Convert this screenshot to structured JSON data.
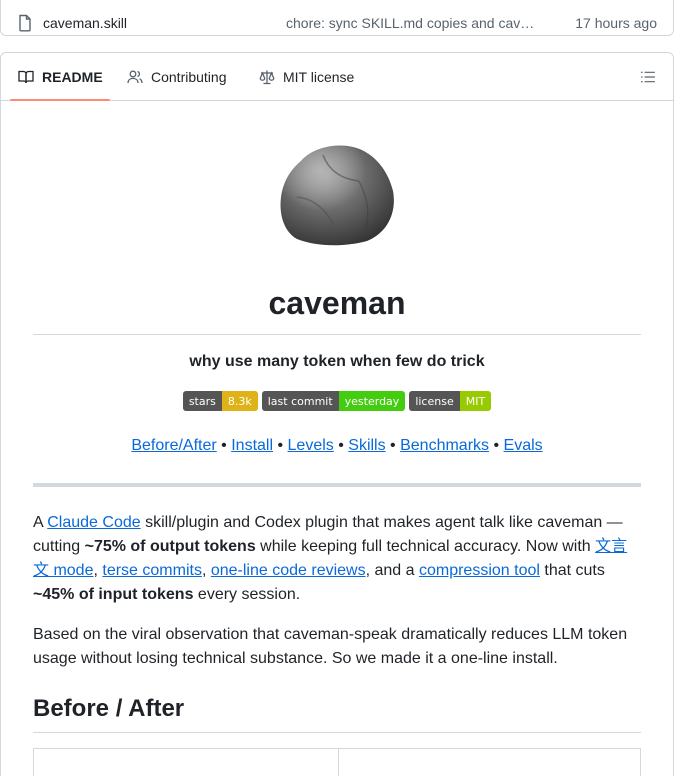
{
  "file_row": {
    "name": "caveman.skill",
    "commit_message": "chore: sync SKILL.md copies and cav…",
    "time": "17 hours ago"
  },
  "tabs": [
    {
      "label": "README",
      "icon": "book-icon",
      "active": true
    },
    {
      "label": "Contributing",
      "icon": "people-icon",
      "active": false
    },
    {
      "label": "MIT license",
      "icon": "law-icon",
      "active": false
    }
  ],
  "readme": {
    "title": "caveman",
    "tagline": "why use many token when few do trick",
    "badges": [
      {
        "label": "stars",
        "value": "8.3k",
        "color": "#dfb317"
      },
      {
        "label": "last commit",
        "value": "yesterday",
        "color": "#4c1"
      },
      {
        "label": "license",
        "value": "MIT",
        "color": "#97ca00"
      }
    ],
    "nav": {
      "before_after": "Before/After",
      "install": "Install",
      "levels": "Levels",
      "skills": "Skills",
      "benchmarks": "Benchmarks",
      "evals": "Evals",
      "separator": " • "
    },
    "p1": {
      "t1": "A ",
      "link_claude": "Claude Code",
      "t2": " skill/plugin and Codex plugin that makes agent talk like caveman — cutting ",
      "bold_output": "~75% of output tokens",
      "t3": " while keeping full technical accuracy. Now with ",
      "link_wenyan": "文言文 mode",
      "t4": ", ",
      "link_terse": "terse commits",
      "t5": ", ",
      "link_oneline": "one-line code reviews",
      "t6": ", and a ",
      "link_compression": "compression tool",
      "t7": " that cuts ",
      "bold_input": "~45% of input tokens",
      "t8": " every session."
    },
    "p2": "Based on the viral observation that caveman-speak dramatically reduces LLM token usage without losing technical substance. So we made it a one-line install.",
    "section_heading": "Before / After"
  }
}
